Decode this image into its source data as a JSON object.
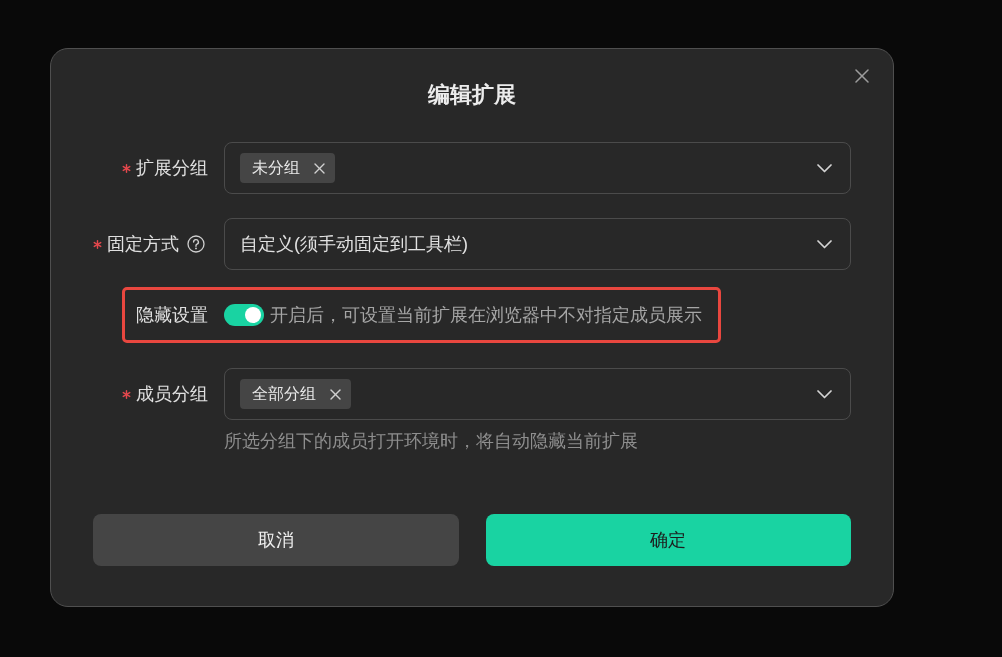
{
  "dialog": {
    "title": "编辑扩展"
  },
  "fields": [
    {
      "kind": "select",
      "label": "扩展分组",
      "required": true,
      "help": false,
      "tags": [
        "未分组"
      ]
    },
    {
      "kind": "select",
      "label": "固定方式",
      "required": true,
      "help": true,
      "value": "自定义(须手动固定到工具栏)"
    },
    {
      "kind": "switch",
      "label": "隐藏设置",
      "required": false,
      "help": false,
      "on": true,
      "description": "开启后，可设置当前扩展在浏览器中不对指定成员展示",
      "highlighted": true
    },
    {
      "kind": "select",
      "label": "成员分组",
      "required": true,
      "help": false,
      "tags": [
        "全部分组"
      ],
      "hint": "所选分组下的成员打开环境时，将自动隐藏当前扩展"
    }
  ],
  "buttons": [
    {
      "label": "取消",
      "kind": "secondary"
    },
    {
      "label": "确定",
      "kind": "primary"
    }
  ]
}
